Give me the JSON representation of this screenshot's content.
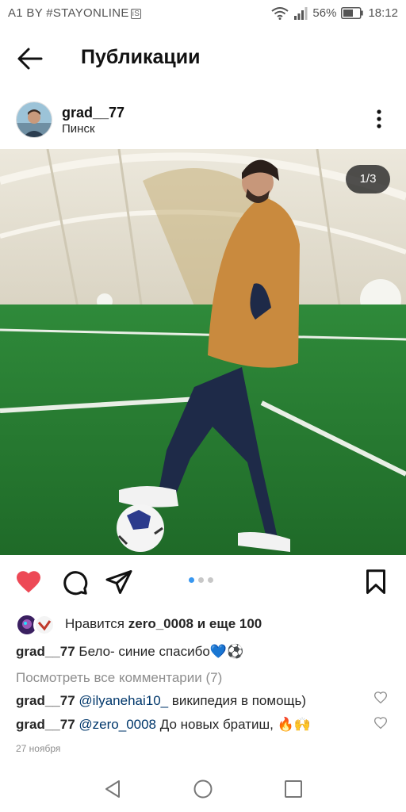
{
  "status_bar": {
    "carrier": "A1 BY #STAYONLINE",
    "carrier_badge": "iS",
    "battery": "56%",
    "time": "18:12"
  },
  "header": {
    "title": "Публикации"
  },
  "post": {
    "username": "grad__77",
    "location": "Пинск",
    "counter": "1/3",
    "carousel": {
      "total": 3,
      "active": 1
    },
    "likes": {
      "prefix": "Нравится",
      "user": "zero_0008",
      "suffix": "и еще 100"
    },
    "caption": {
      "user": "grad__77",
      "text": "Бело- синие спасибо",
      "emoji": "💙⚽"
    },
    "view_comments": "Посмотреть все комментарии (7)",
    "comments": [
      {
        "user": "grad__77",
        "mention": "@ilyanehai10_",
        "text": "википедия в помощь)"
      },
      {
        "user": "grad__77",
        "mention": "@zero_0008",
        "text": "До новых братиш,",
        "emoji": "🔥🙌"
      }
    ],
    "date": "27 ноября"
  },
  "colors": {
    "like_red": "#ed4956",
    "accent_blue": "#3897f0",
    "mention_blue": "#00376b"
  },
  "icons": [
    "back-arrow-icon",
    "more-vertical-icon",
    "heart-icon",
    "comment-icon",
    "share-icon",
    "bookmark-icon",
    "nav-back-icon",
    "nav-home-icon",
    "nav-recents-icon"
  ]
}
